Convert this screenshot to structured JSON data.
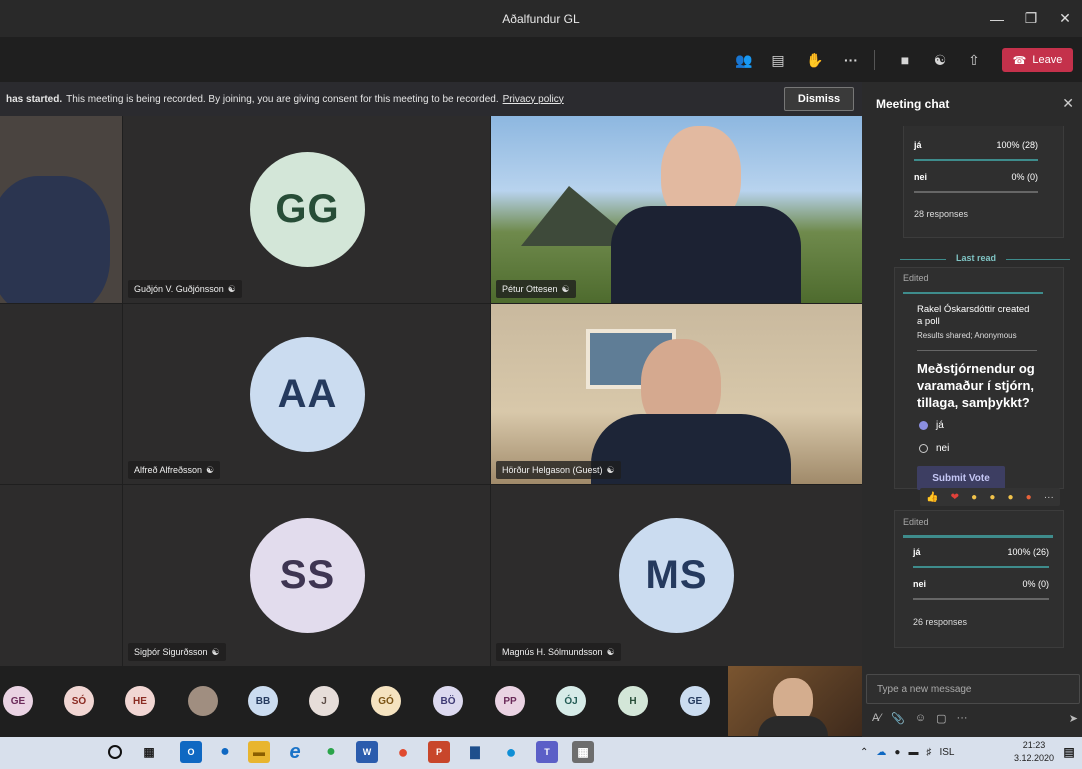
{
  "window": {
    "title": "Aðalfundur GL"
  },
  "toolbar": {
    "leave_label": "Leave"
  },
  "banner": {
    "bold_text": "has started.",
    "text": "This meeting is being recorded. By joining, you are giving consent for this meeting to be recorded.",
    "privacy_link": "Privacy policy",
    "dismiss_label": "Dismiss"
  },
  "participants": [
    {
      "initials": "GG",
      "name": "Guðjón V. Guðjónsson"
    },
    {
      "initials": "",
      "name": "Pétur Ottesen"
    },
    {
      "initials": "AA",
      "name": "Alfreð Alfreðsson"
    },
    {
      "initials": "",
      "name": "Hörður Helgason (Guest)"
    },
    {
      "initials": "SS",
      "name": "Sigþór Sigurðsson"
    },
    {
      "initials": "MS",
      "name": "Magnús H. Sólmundsson"
    }
  ],
  "strip": [
    "GE",
    "SÓ",
    "HE",
    "",
    "BB",
    "J",
    "GÓ",
    "BÖ",
    "PP",
    "ÓJ",
    "H",
    "GE"
  ],
  "chat": {
    "title": "Meeting chat",
    "poll1": {
      "opt1": "já",
      "pct1": "100% (28)",
      "opt2": "nei",
      "pct2": "0% (0)",
      "responses": "28 responses"
    },
    "last_read": "Last read",
    "edited1": "Edited",
    "poll_created": "Rakel Óskarsdóttir created a poll",
    "poll_meta": "Results shared; Anonymous",
    "question": "Meðstjórnendur og varamaður í stjórn, tillaga, samþykkt?",
    "choice1": "já",
    "choice2": "nei",
    "submit_label": "Submit Vote",
    "edited2": "Edited",
    "poll2": {
      "opt1": "já",
      "pct1": "100% (26)",
      "opt2": "nei",
      "pct2": "0% (0)",
      "responses": "26 responses"
    },
    "composer_placeholder": "Type a new message"
  },
  "taskbar": {
    "lang": "ISL",
    "time": "21:23",
    "date": "3.12.2020"
  },
  "colors": {
    "leave": "#c4314b",
    "accent": "#3e8c8c",
    "submit": "#5b5fc7"
  }
}
